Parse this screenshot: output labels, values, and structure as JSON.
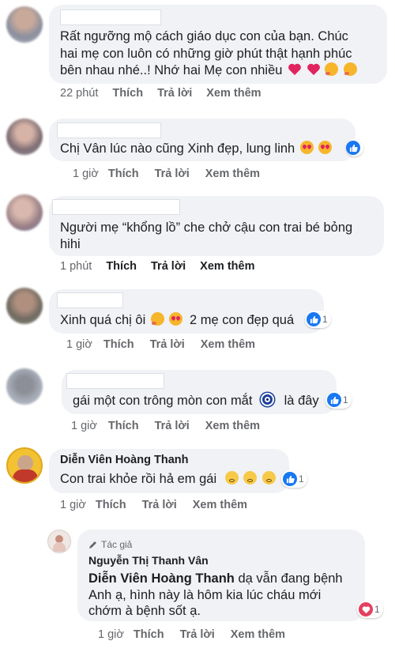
{
  "comments": [
    {
      "text_lines": [
        "Rất ngưỡng mộ cách giáo dục con của bạn. Chúc",
        "hai mẹ con luôn có những giờ phút thật hạnh phúc",
        "bên nhau nhé..! Nhớ hai Mẹ con nhiều"
      ],
      "emojis": [
        "heart",
        "heart",
        "smiling-face-hearts",
        "smiling-face-hearts"
      ],
      "time": "22 phút",
      "like": "Thích",
      "reply": "Trả lời",
      "more": "Xem thêm"
    },
    {
      "text": "Chị Vân lúc nào cũng Xinh đẹp, lung linh",
      "emojis": [
        "heart-eyes",
        "heart-eyes"
      ],
      "reaction": "like",
      "time": "1 giờ",
      "like": "Thích",
      "reply": "Trả lời",
      "more": "Xem thêm"
    },
    {
      "text_lines": [
        "Người mẹ “khổng lồ” che chở cậu con trai bé bỏng",
        "hihi"
      ],
      "time": "1 phút",
      "like": "Thích",
      "reply": "Trả lời",
      "more": "Xem thêm"
    },
    {
      "text_a": "Xinh quá chị ôi",
      "text_b": "2 mẹ con đẹp quá",
      "emojis": [
        "smiling-face-hearts",
        "heart-eyes"
      ],
      "reaction": "like",
      "reaction_count": "1",
      "time": "1 giờ",
      "like": "Thích",
      "reply": "Trả lời",
      "more": "Xem thêm"
    },
    {
      "text_a": "gái một con trông mòn con mắt",
      "text_b": "là đây",
      "emojis": [
        "nazar-amulet"
      ],
      "reaction": "like",
      "reaction_count": "1",
      "time": "1 giờ",
      "like": "Thích",
      "reply": "Trả lời",
      "more": "Xem thêm"
    },
    {
      "author": "Diễn Viên Hoàng Thanh",
      "text": "Con trai khỏe rồi hả em gái",
      "emojis": [
        "sad-face",
        "sad-face",
        "sad-face"
      ],
      "reaction": "like",
      "reaction_count": "1",
      "time": "1 giờ",
      "like": "Thích",
      "reply": "Trả lời",
      "more": "Xem thêm"
    },
    {
      "author_badge": "Tác giả",
      "author": "Nguyễn Thị Thanh Vân",
      "mention": "Diễn Viên Hoàng Thanh",
      "text_first": " dạ vẫn đang bệnh",
      "text_lines": [
        "Anh ạ, hình này là hôm kia lúc cháu mới",
        "chớm à bệnh sốt ạ."
      ],
      "reaction": "love",
      "reaction_count": "1",
      "time": "1 giờ",
      "like": "Thích",
      "reply": "Trả lời",
      "more": "Xem thêm"
    }
  ],
  "colors": {
    "bubble": "#f0f2f5",
    "meta": "#65676b",
    "text": "#1c1e21",
    "like_blue": "#1877f2",
    "love_red": "#e4405f"
  }
}
